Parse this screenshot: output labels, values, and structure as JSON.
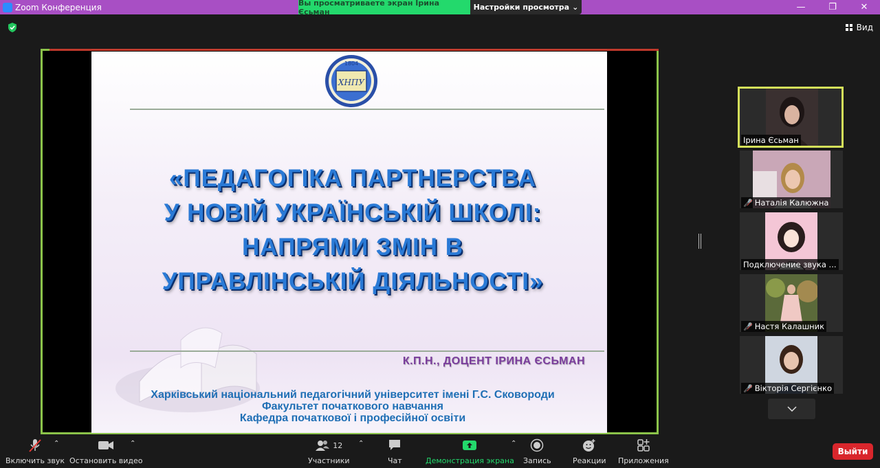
{
  "window": {
    "title": "Zoom Конференция",
    "share_banner": "Вы просматриваете экран Ірина Єсьман",
    "view_settings": "Настройки просмотра",
    "minimize": "—",
    "maximize": "❐",
    "close": "✕"
  },
  "header": {
    "view_label": "Вид"
  },
  "slide": {
    "logo_year": "1804",
    "logo_text": "ХНПУ",
    "title_lines": [
      "«ПЕДАГОГІКА ПАРТНЕРСТВА",
      "У НОВІЙ УКРАЇНСЬКІЙ ШКОЛІ:",
      "НАПРЯМИ ЗМІН В",
      "УПРАВЛІНСЬКІЙ ДІЯЛЬНОСТІ»"
    ],
    "author": "К.П.Н., ДОЦЕНТ   ІРИНА ЄСЬМАН",
    "university_lines": [
      "Харківський національний педагогічний університет імені Г.С. Сковороди",
      "Факультет початкового навчання",
      "Кафедра початкової і професійної освіти"
    ]
  },
  "participants": [
    {
      "name": "Ірина Єсьман",
      "muted": false,
      "active": true
    },
    {
      "name": "Наталія Калюжна",
      "muted": true,
      "active": false
    },
    {
      "name": "Подключение звука ...",
      "muted": false,
      "active": false
    },
    {
      "name": "Настя Калашник",
      "muted": true,
      "active": false
    },
    {
      "name": "Вікторія Сергієнко",
      "muted": true,
      "active": false
    }
  ],
  "toolbar": {
    "unmute": "Включить звук",
    "stop_video": "Остановить видео",
    "participants": "Участники",
    "participants_count": "12",
    "chat": "Чат",
    "share_screen": "Демонстрация экрана",
    "record": "Запись",
    "reactions": "Реакции",
    "apps": "Приложения",
    "leave": "Выйти"
  },
  "colors": {
    "titlebar": "#a84fc4",
    "share_banner": "#23d96c",
    "active_border": "#d4e05a",
    "share_frame": "#8bc34a",
    "leave": "#d9262c",
    "slide_title": "#2a7ad6",
    "author": "#7a3d9c",
    "university": "#1f6fb5"
  }
}
